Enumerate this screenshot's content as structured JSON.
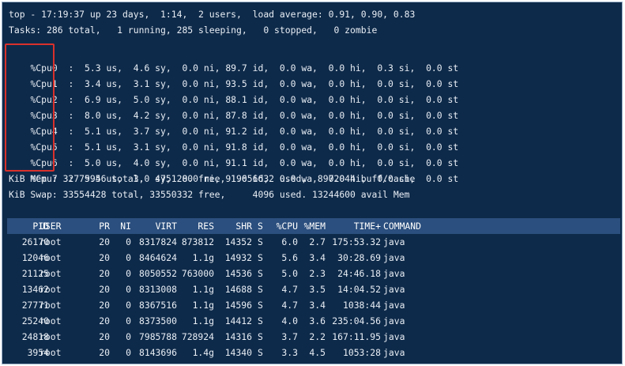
{
  "summary": {
    "uptime_line": "top - 17:19:37 up 23 days,  1:14,  2 users,  load average: 0.91, 0.90, 0.83",
    "tasks_line": "Tasks: 286 total,   1 running, 285 sleeping,   0 stopped,   0 zombie",
    "mem_line": "KiB Mem : 32779956 total,  4751280 free, 19056632 used,  8972044 buff/cache",
    "swap_line": "KiB Swap: 33554428 total, 33550332 free,     4096 used. 13244600 avail Mem"
  },
  "cpus": [
    {
      "label": "%Cpu0  :",
      "stats": "  5.3 us,  4.6 sy,  0.0 ni, 89.7 id,  0.0 wa,  0.0 hi,  0.3 si,  0.0 st"
    },
    {
      "label": "%Cpu1  :",
      "stats": "  3.4 us,  3.1 sy,  0.0 ni, 93.5 id,  0.0 wa,  0.0 hi,  0.0 si,  0.0 st"
    },
    {
      "label": "%Cpu2  :",
      "stats": "  6.9 us,  5.0 sy,  0.0 ni, 88.1 id,  0.0 wa,  0.0 hi,  0.0 si,  0.0 st"
    },
    {
      "label": "%Cpu3  :",
      "stats": "  8.0 us,  4.2 sy,  0.0 ni, 87.8 id,  0.0 wa,  0.0 hi,  0.0 si,  0.0 st"
    },
    {
      "label": "%Cpu4  :",
      "stats": "  5.1 us,  3.7 sy,  0.0 ni, 91.2 id,  0.0 wa,  0.0 hi,  0.0 si,  0.0 st"
    },
    {
      "label": "%Cpu5  :",
      "stats": "  5.1 us,  3.1 sy,  0.0 ni, 91.8 id,  0.0 wa,  0.0 hi,  0.0 si,  0.0 st"
    },
    {
      "label": "%Cpu6  :",
      "stats": "  5.0 us,  4.0 sy,  0.0 ni, 91.1 id,  0.0 wa,  0.0 hi,  0.0 si,  0.0 st"
    },
    {
      "label": "%Cpu7  :",
      "stats": "  5.4 us,  3.0 sy,  0.0 ni, 91.6 id,  0.0 wa,  0.0 hi,  0.0 si,  0.0 st"
    }
  ],
  "process_table": {
    "headers": {
      "pid": "PID",
      "user": "USER",
      "pr": "PR",
      "ni": "NI",
      "virt": "VIRT",
      "res": "RES",
      "shr": "SHR",
      "s": "S",
      "cpu": "%CPU",
      "mem": "%MEM",
      "time": "TIME+",
      "command": "COMMAND"
    },
    "rows": [
      {
        "pid": "26170",
        "user": "root",
        "pr": "20",
        "ni": "0",
        "virt": "8317824",
        "res": "873812",
        "shr": "14352",
        "s": "S",
        "cpu": "6.0",
        "mem": "2.7",
        "time": "175:53.32",
        "command": "java"
      },
      {
        "pid": "12046",
        "user": "root",
        "pr": "20",
        "ni": "0",
        "virt": "8464624",
        "res": "1.1g",
        "shr": "14932",
        "s": "S",
        "cpu": "5.6",
        "mem": "3.4",
        "time": "30:28.69",
        "command": "java"
      },
      {
        "pid": "21125",
        "user": "root",
        "pr": "20",
        "ni": "0",
        "virt": "8050552",
        "res": "763000",
        "shr": "14536",
        "s": "S",
        "cpu": "5.0",
        "mem": "2.3",
        "time": "24:46.18",
        "command": "java"
      },
      {
        "pid": "13462",
        "user": "root",
        "pr": "20",
        "ni": "0",
        "virt": "8313008",
        "res": "1.1g",
        "shr": "14688",
        "s": "S",
        "cpu": "4.7",
        "mem": "3.5",
        "time": "14:04.52",
        "command": "java"
      },
      {
        "pid": "27771",
        "user": "root",
        "pr": "20",
        "ni": "0",
        "virt": "8367516",
        "res": "1.1g",
        "shr": "14596",
        "s": "S",
        "cpu": "4.7",
        "mem": "3.4",
        "time": "1038:44",
        "command": "java"
      },
      {
        "pid": "25240",
        "user": "root",
        "pr": "20",
        "ni": "0",
        "virt": "8373500",
        "res": "1.1g",
        "shr": "14412",
        "s": "S",
        "cpu": "4.0",
        "mem": "3.6",
        "time": "235:04.56",
        "command": "java"
      },
      {
        "pid": "24818",
        "user": "root",
        "pr": "20",
        "ni": "0",
        "virt": "7985788",
        "res": "728924",
        "shr": "14316",
        "s": "S",
        "cpu": "3.7",
        "mem": "2.2",
        "time": "167:11.95",
        "command": "java"
      },
      {
        "pid": "3954",
        "user": "root",
        "pr": "20",
        "ni": "0",
        "virt": "8143696",
        "res": "1.4g",
        "shr": "14340",
        "s": "S",
        "cpu": "3.3",
        "mem": "4.5",
        "time": "1053:28",
        "command": "java"
      }
    ]
  },
  "colors": {
    "terminal_background": "#0e2a4a",
    "header_bar": "#2b4f7e",
    "highlight_border": "#d9312b"
  }
}
